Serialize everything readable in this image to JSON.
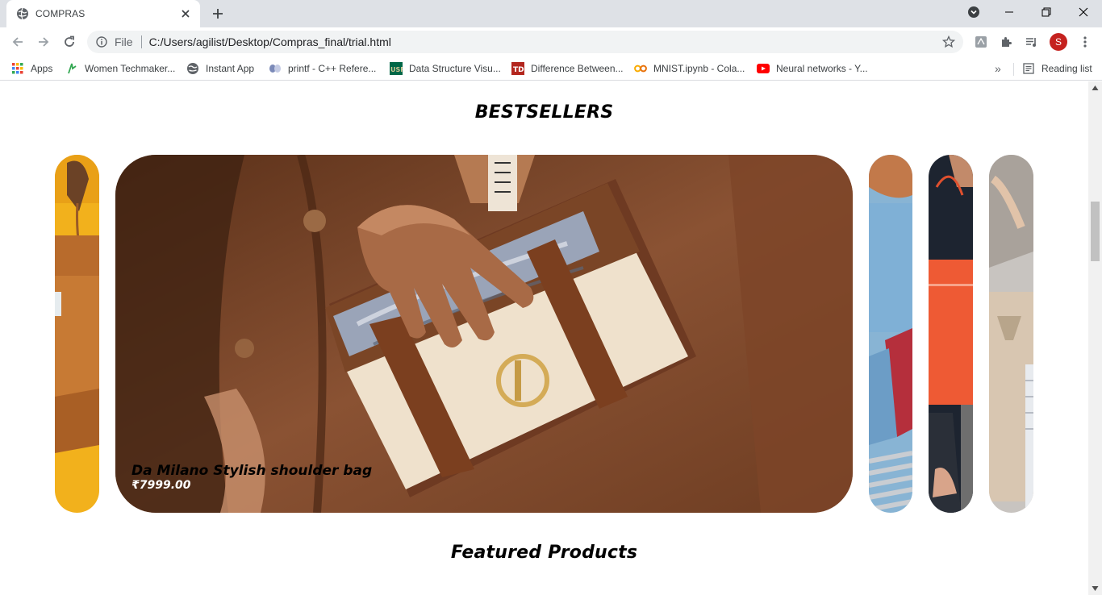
{
  "browser": {
    "tab": {
      "title": "COMPRAS",
      "favicon": "globe-icon"
    },
    "omnibox": {
      "scheme": "File",
      "url": "C:/Users/agilist/Desktop/Compras_final/trial.html"
    },
    "profile_initial": "S",
    "bookmarks": [
      {
        "label": "Apps",
        "icon": "apps-grid-icon"
      },
      {
        "label": "Women Techmaker...",
        "icon": "wtm-icon"
      },
      {
        "label": "Instant App",
        "icon": "globe-icon"
      },
      {
        "label": "printf - C++ Refere...",
        "icon": "cpp-icon"
      },
      {
        "label": "Data Structure Visu...",
        "icon": "usf-icon"
      },
      {
        "label": "Difference Between...",
        "icon": "td-icon"
      },
      {
        "label": "MNIST.ipynb - Cola...",
        "icon": "colab-icon"
      },
      {
        "label": "Neural networks - Y...",
        "icon": "youtube-icon"
      }
    ],
    "reading_list": "Reading list",
    "more_bookmarks": "»"
  },
  "page": {
    "bestsellers_title": "BESTSELLERS",
    "featured_title": "Featured Products",
    "featured_product": {
      "name": "Da Milano Stylish shoulder bag",
      "price": "₹7999.00"
    }
  },
  "colors": {
    "tab_strip": "#dee1e6",
    "profile": "#c5221f",
    "bag_brown": "#7a4526",
    "coat_brown": "#8a5233"
  }
}
